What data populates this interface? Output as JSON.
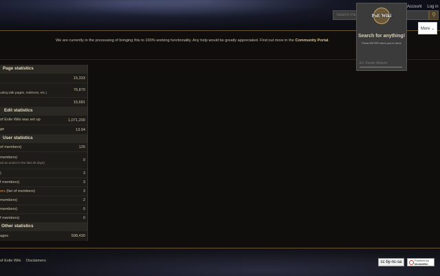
{
  "header": {
    "links": [
      "Account",
      "Log in"
    ],
    "search_placeholder": "Search Pa",
    "search_go_icon": "magnifier-icon"
  },
  "search_panel": {
    "logo_text": "PoE Wiki",
    "title": "Search for anything!",
    "hint": "Press ENTER when you're done",
    "input_placeholder": "Ex: Faster Attacks",
    "more_label": "More"
  },
  "notice": {
    "text": "We are currently in the processing of bringing this to 100% working functionality. Any help would be greatly appreciated. Find out more in the",
    "link": "Community Portal",
    "end": "."
  },
  "stats": {
    "page_title": "Page statistics",
    "page_rows": [
      {
        "label": "",
        "value": "15,333"
      },
      {
        "label": "uding talk pages, redirects, etc.)",
        "value": "76,870"
      },
      {
        "label": "",
        "value": "15,681"
      }
    ],
    "edit_title": "Edit statistics",
    "edit_rows": [
      {
        "label": "of Exile Wiki was set up",
        "value": "1,071,200"
      },
      {
        "label": "ge",
        "value": "13.94"
      }
    ],
    "user_title": "User statistics",
    "user_rows": [
      {
        "label": "of members)",
        "sub": "",
        "value": "125"
      },
      {
        "label": "members)",
        "sub": "ed an action in the last 30 days)",
        "value": "0"
      },
      {
        "label": ")",
        "sub": "",
        "value": "3"
      },
      {
        "label": "f members)",
        "sub": "",
        "value": "3"
      },
      {
        "label": "ors",
        "label_rest": " (list of members)",
        "sub": "",
        "value": "3"
      },
      {
        "label": "members)",
        "sub": "",
        "value": "2"
      },
      {
        "label": "members)",
        "sub": "",
        "value": "0"
      },
      {
        "label": "f members)",
        "sub": "",
        "value": "0"
      }
    ],
    "other_title": "Other statistics",
    "other_rows": [
      {
        "label": "ages",
        "value": "598,430"
      }
    ]
  },
  "footer": {
    "links": [
      "of Exile Wiki",
      "Disclaimers"
    ],
    "cc_badge": "cc by-nc-sa",
    "mw_badge_line1": "Powered by",
    "mw_badge_line2": "MediaWiki"
  }
}
